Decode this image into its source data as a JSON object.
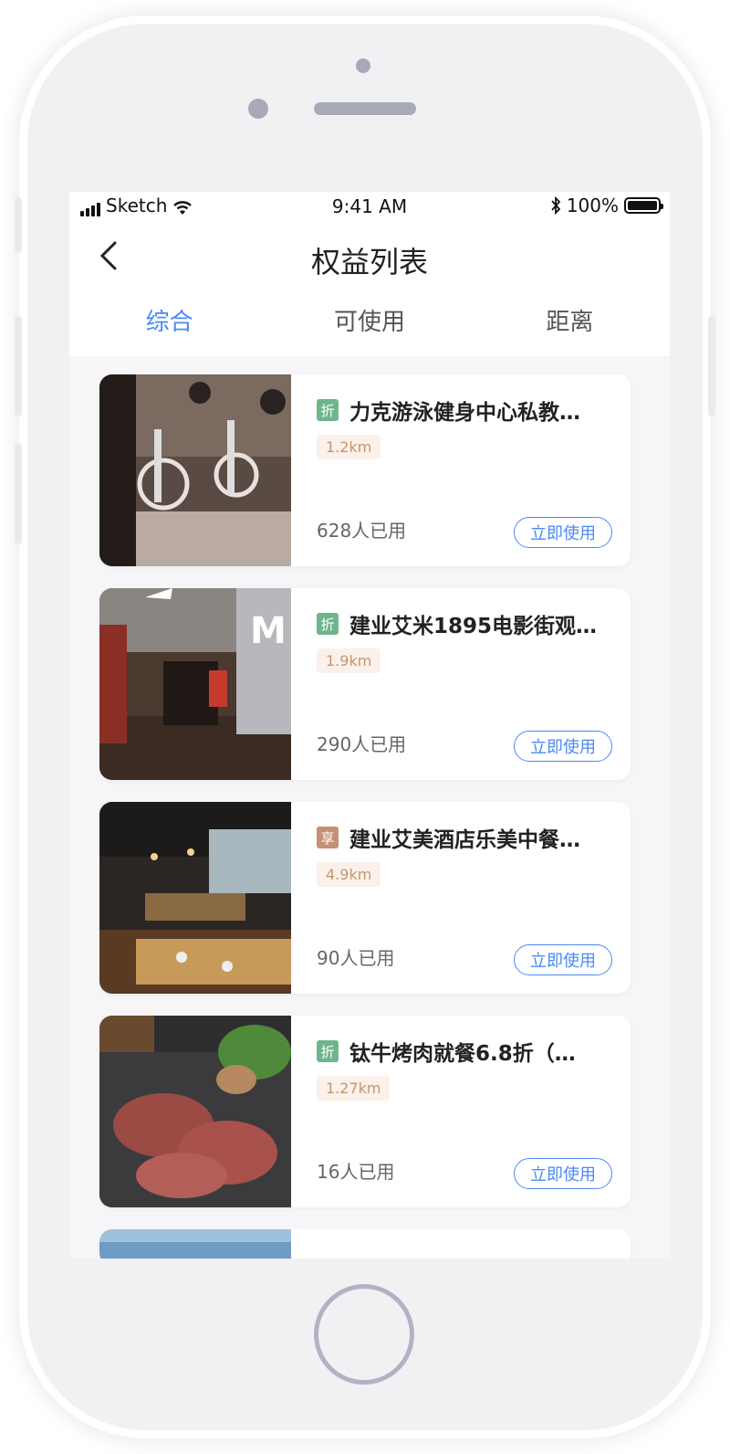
{
  "status_bar": {
    "carrier": "Sketch",
    "time": "9:41 AM",
    "battery": "100%"
  },
  "nav": {
    "title": "权益列表"
  },
  "tabs": [
    {
      "label": "综合",
      "active": true
    },
    {
      "label": "可使用",
      "active": false
    },
    {
      "label": "距离",
      "active": false
    }
  ],
  "items": [
    {
      "tag": "折",
      "tag_color": "#6fb58c",
      "title": "力克游泳健身中心私教…",
      "distance": "1.2km",
      "used": "628人已用",
      "button": "立即使用"
    },
    {
      "tag": "折",
      "tag_color": "#6fb58c",
      "title": "建业艾米1895电影街观…",
      "distance": "1.9km",
      "used": "290人已用",
      "button": "立即使用"
    },
    {
      "tag": "享",
      "tag_color": "#c39073",
      "title": "建业艾美酒店乐美中餐…",
      "distance": "4.9km",
      "used": "90人已用",
      "button": "立即使用"
    },
    {
      "tag": "折",
      "tag_color": "#6fb58c",
      "title": "钛牛烤肉就餐6.8折（…",
      "distance": "1.27km",
      "used": "16人已用",
      "button": "立即使用"
    }
  ],
  "colors": {
    "accent": "#4a8af4",
    "distance_text": "#c4966b",
    "distance_bg": "#fbf1ea"
  }
}
